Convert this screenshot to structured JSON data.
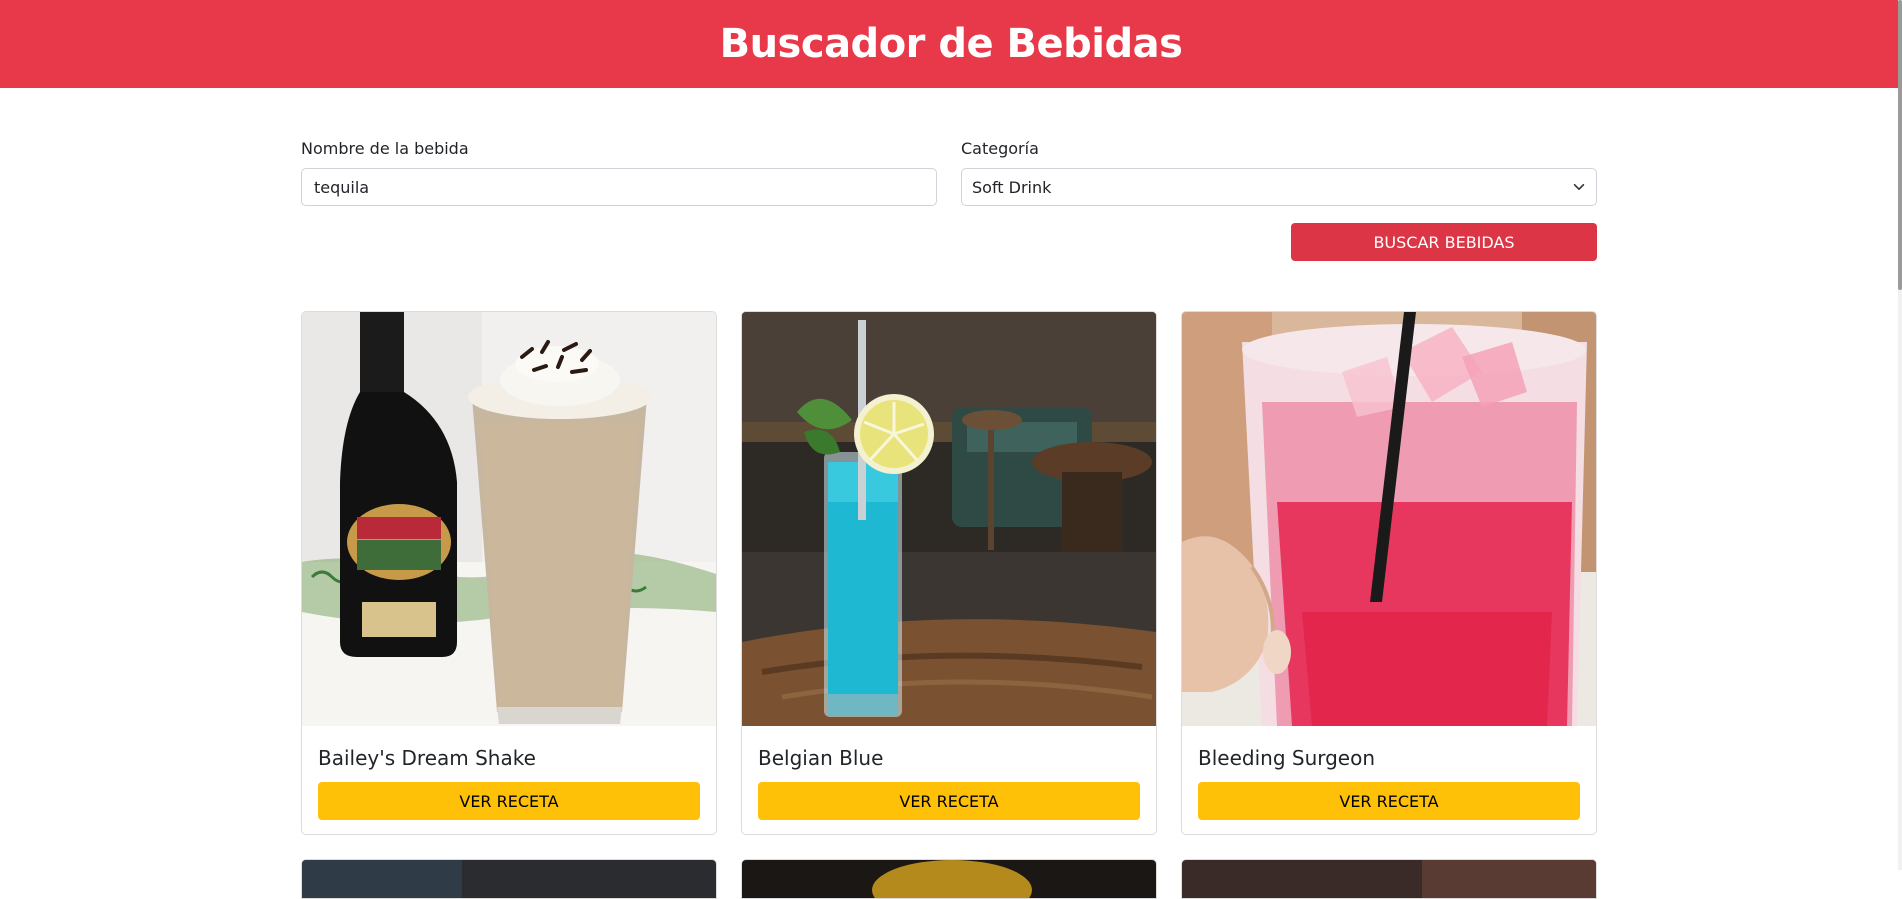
{
  "header": {
    "title": "Buscador de Bebidas"
  },
  "form": {
    "name_label": "Nombre de la bebida",
    "name_value": "tequila",
    "category_label": "Categoría",
    "category_value": "Soft Drink",
    "search_button": "Buscar Bebidas"
  },
  "drinks": [
    {
      "name": "Bailey's Dream Shake",
      "button": "Ver Receta"
    },
    {
      "name": "Belgian Blue",
      "button": "Ver Receta"
    },
    {
      "name": "Bleeding Surgeon",
      "button": "Ver Receta"
    }
  ],
  "colors": {
    "header_bg": "#e8394a",
    "search_button_bg": "#dc3545",
    "recipe_button_bg": "#ffc107"
  }
}
